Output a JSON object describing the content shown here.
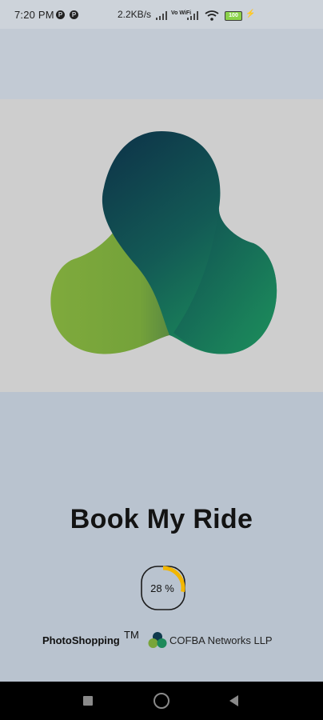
{
  "status_bar": {
    "time": "7:20 PM",
    "notif_icon_1": "p-circle-icon",
    "notif_icon_1_glyph": "P",
    "notif_icon_2": "p-circle-icon",
    "notif_icon_2_glyph": "P",
    "net_speed": "2.2KB/s",
    "volte_text": "Vo WiFi",
    "battery_text": "100"
  },
  "app": {
    "title": "Book My Ride"
  },
  "progress": {
    "label": "28 %",
    "percent": 28,
    "color": "#f2b600"
  },
  "footer": {
    "brand": "PhotoShopping",
    "trademark": "TM",
    "company": "COFBA Networks LLP"
  },
  "colors": {
    "logo_dark": "#0f3a4d",
    "logo_teal": "#1d8a5a",
    "logo_green": "#79a53a",
    "nav_bar": "#000000"
  }
}
